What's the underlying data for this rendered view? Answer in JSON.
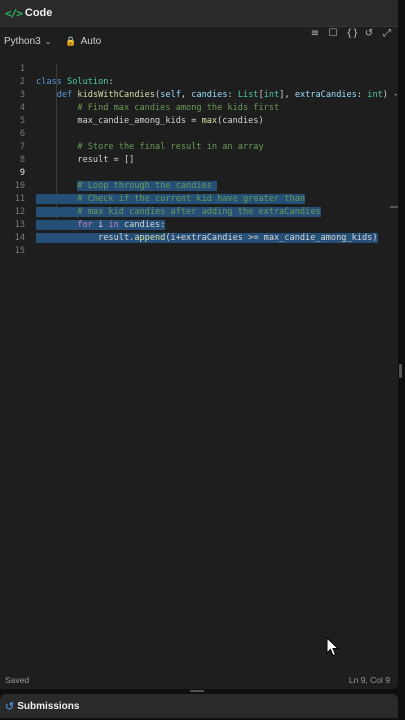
{
  "header": {
    "title": "Code"
  },
  "toolbar": {
    "language": "Python3",
    "mode": "Auto",
    "icons": [
      "format-icon",
      "bookmark-icon",
      "braces-icon",
      "reset-icon",
      "expand-icon"
    ]
  },
  "editor": {
    "line_numbers": [
      "1",
      "2",
      "3",
      "4",
      "5",
      "6",
      "7",
      "8",
      "9",
      "10",
      "11",
      "12",
      "13",
      "14",
      "15"
    ],
    "active_line": "9",
    "lines": [
      "class Solution:",
      "    def kidsWithCandies(self, candies: List[int], extraCandies: int) ->",
      "        # Find max candies among the kids first",
      "        max_candie_among_kids = max(candies)",
      "",
      "        # Store the final result in an array",
      "        result = []",
      "",
      "        # Loop through the candies ",
      "        # Check if the current kid have greater than",
      "        # max kid candies after adding the extraCandies",
      "        for i in candies:",
      "            result.append(i+extraCandies >= max_candie_among_kids)",
      "",
      ""
    ]
  },
  "status": {
    "saved": "Saved",
    "position": "Ln 9, Col 9"
  },
  "submissions": {
    "title": "Submissions"
  },
  "colors": {
    "background": "#1e1e1e",
    "selection": "#264f78",
    "keyword": "#569cd6",
    "comment": "#6a9955",
    "accent_green": "#2cbb5d"
  }
}
